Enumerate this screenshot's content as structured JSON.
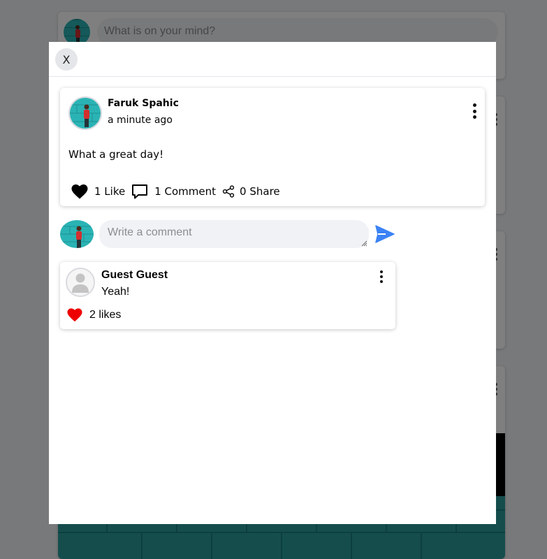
{
  "composer": {
    "placeholder": "What is on your mind?"
  },
  "modal": {
    "close_label": "X",
    "post": {
      "author": "Faruk Spahic",
      "time": "a minute ago",
      "text": "What a great day!",
      "actions": {
        "like_label": "1 Like",
        "comment_label": "1 Comment",
        "share_label": "0 Share"
      }
    },
    "comment_box": {
      "placeholder": "Write a comment"
    },
    "comments": [
      {
        "author": "Guest Guest",
        "text": "Yeah!",
        "likes_label": "2 likes"
      }
    ]
  },
  "colors": {
    "overlay": "#000000",
    "accent_send": "#3b82f6",
    "like_heart": "#ee0000",
    "avatar_wall": "#2ab3b4",
    "input_bg": "#f0f2f5"
  },
  "icons": {
    "close": "x-text",
    "kebab": "more-vertical-icon",
    "like": "heart-icon",
    "comment": "speech-bubble-icon",
    "share": "share-nodes-icon",
    "send": "paper-plane-icon",
    "guest_avatar": "user-silhouette-icon"
  }
}
